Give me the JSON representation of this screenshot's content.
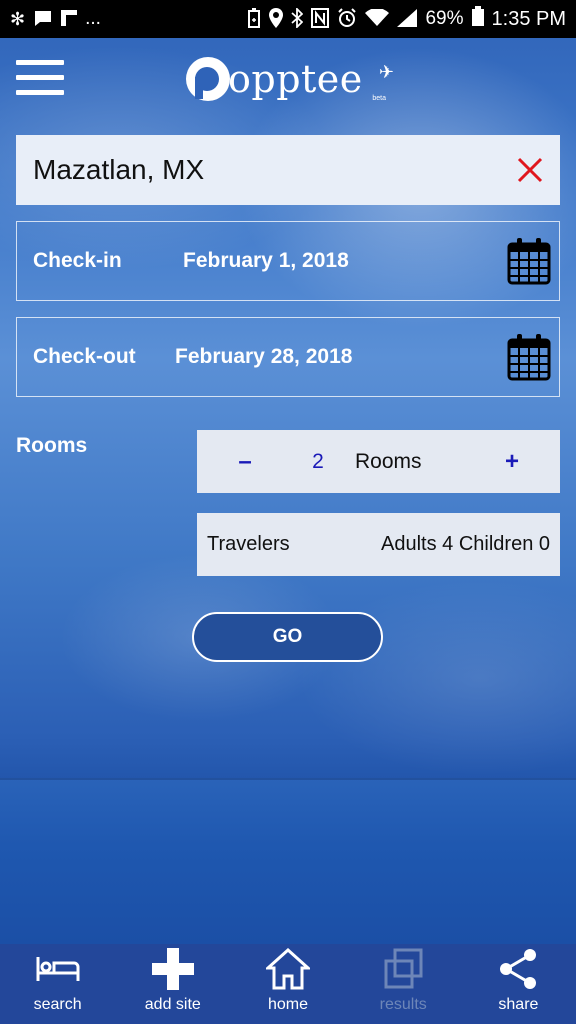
{
  "status_bar": {
    "left_icons": [
      "pinwheel-icon",
      "chat-icon",
      "flipboard-icon"
    ],
    "overflow": "...",
    "right_icons": [
      "battery-saver-icon",
      "location-icon",
      "bluetooth-icon",
      "nfc-icon",
      "alarm-icon",
      "wifi-icon",
      "signal-icon"
    ],
    "battery": "69%",
    "time": "1:35 PM"
  },
  "header": {
    "logo_text": "opptee",
    "logo_badge": "beta"
  },
  "search": {
    "destination": "Mazatlan, MX"
  },
  "dates": {
    "checkin_label": "Check-in",
    "checkin_value": "February 1, 2018",
    "checkout_label": "Check-out",
    "checkout_value": "February 28, 2018"
  },
  "rooms": {
    "label": "Rooms",
    "minus": "–",
    "count": "2",
    "unit": "Rooms",
    "plus": "+"
  },
  "travelers": {
    "label": "Travelers",
    "value": "Adults 4 Children 0"
  },
  "go_label": "GO",
  "bottom_nav": [
    {
      "label": "search",
      "icon": "bed-icon",
      "enabled": true
    },
    {
      "label": "add site",
      "icon": "plus-icon",
      "enabled": true
    },
    {
      "label": "home",
      "icon": "home-icon",
      "enabled": true
    },
    {
      "label": "results",
      "icon": "stacked-squares-icon",
      "enabled": false
    },
    {
      "label": "share",
      "icon": "share-icon",
      "enabled": true
    }
  ],
  "colors": {
    "accent": "#1a1ab8",
    "clear": "#e0161e",
    "nav_bg": "#23479a",
    "button_bg": "#244f9a"
  }
}
